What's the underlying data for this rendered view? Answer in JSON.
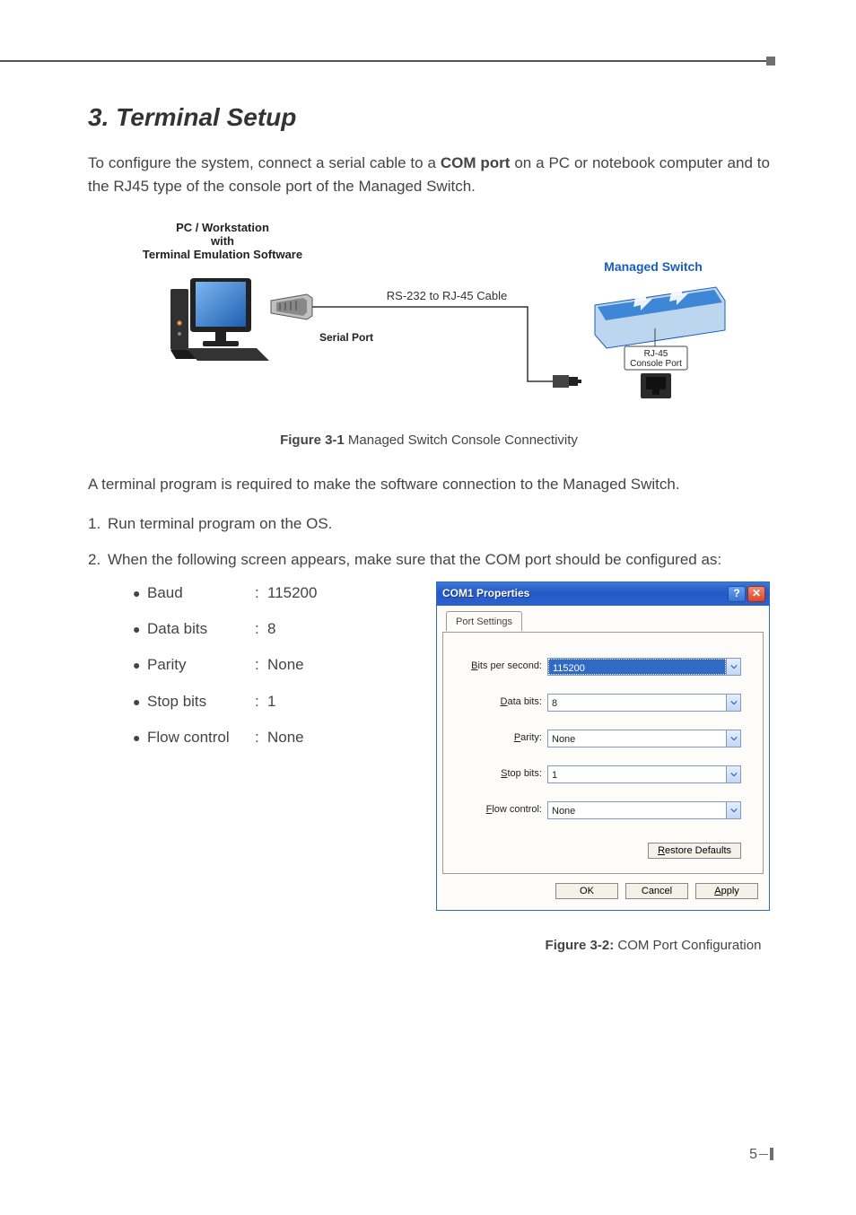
{
  "section": {
    "title": "3. Terminal Setup",
    "intro_pre": "To configure the system, connect a serial cable to a ",
    "intro_bold": "COM port",
    "intro_post": " on a PC or notebook computer and to the RJ45 type of the console port of the Managed Switch."
  },
  "diagram": {
    "pc_label_line1": "PC / Workstation",
    "pc_label_line2": "with",
    "pc_label_line3": "Terminal Emulation Software",
    "serial_port": "Serial Port",
    "cable_label": "RS-232 to RJ-45 Cable",
    "switch_label": "Managed Switch",
    "switch_color": "#1a5db9",
    "console_port_line1": "RJ-45",
    "console_port_line2": "Console Port"
  },
  "figure1": {
    "num": "Figure 3-1",
    "caption": "  Managed Switch Console Connectivity"
  },
  "post_fig_para": "A terminal program is required to make the software connection to the Managed Switch.",
  "steps": [
    "Run terminal program on the OS.",
    "When the following screen appears, make sure that the COM port should be configured as:"
  ],
  "config": [
    {
      "label": "Baud",
      "value": "115200"
    },
    {
      "label": "Data bits",
      "value": "8"
    },
    {
      "label": "Parity",
      "value": "None"
    },
    {
      "label": "Stop bits",
      "value": "1"
    },
    {
      "label": "Flow control",
      "value": "None"
    }
  ],
  "dialog": {
    "title": "COM1 Properties",
    "tab": "Port Settings",
    "fields": [
      {
        "u": "B",
        "rest": "its per second:",
        "value": "115200",
        "selected": true
      },
      {
        "u": "D",
        "rest": "ata bits:",
        "value": "8",
        "selected": false
      },
      {
        "u": "P",
        "rest": "arity:",
        "value": "None",
        "selected": false
      },
      {
        "u": "S",
        "rest": "top bits:",
        "value": "1",
        "selected": false
      },
      {
        "u": "F",
        "rest": "low control:",
        "value": "None",
        "selected": false
      }
    ],
    "restore_u": "R",
    "restore_rest": "estore Defaults",
    "ok": "OK",
    "cancel": "Cancel",
    "apply_u": "A",
    "apply_rest": "pply"
  },
  "figure2": {
    "num": "Figure 3-2:",
    "caption": "  COM Port Configuration"
  },
  "page_number": "5"
}
